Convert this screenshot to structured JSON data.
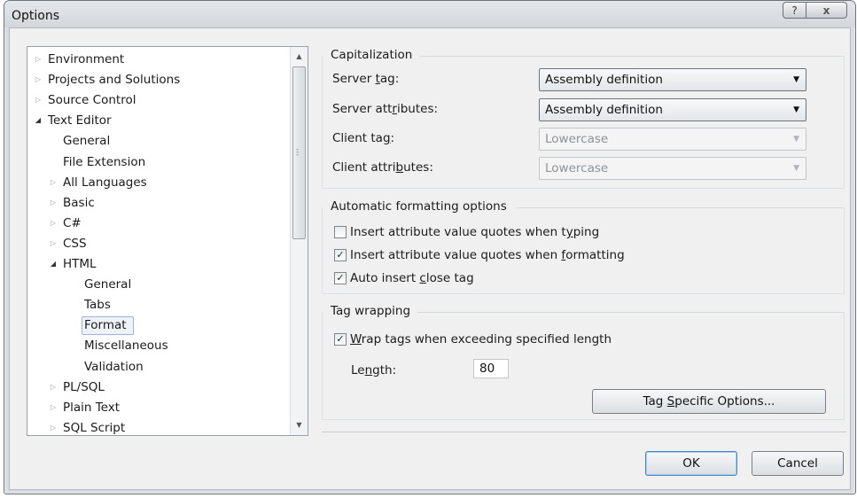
{
  "window": {
    "title": "Options",
    "help_icon": "?",
    "close_icon": "x"
  },
  "tree": {
    "items": [
      {
        "label": "Environment",
        "expander": "collapsed"
      },
      {
        "label": "Projects and Solutions",
        "expander": "collapsed"
      },
      {
        "label": "Source Control",
        "expander": "collapsed"
      },
      {
        "label": "Text Editor",
        "expander": "expanded"
      },
      {
        "label": "General",
        "expander": "none"
      },
      {
        "label": "File Extension",
        "expander": "none"
      },
      {
        "label": "All Languages",
        "expander": "collapsed"
      },
      {
        "label": "Basic",
        "expander": "collapsed"
      },
      {
        "label": "C#",
        "expander": "collapsed"
      },
      {
        "label": "CSS",
        "expander": "collapsed"
      },
      {
        "label": "HTML",
        "expander": "expanded"
      },
      {
        "label": "General",
        "expander": "none"
      },
      {
        "label": "Tabs",
        "expander": "none"
      },
      {
        "label": "Format",
        "expander": "none",
        "selected": true
      },
      {
        "label": "Miscellaneous",
        "expander": "none"
      },
      {
        "label": "Validation",
        "expander": "none"
      },
      {
        "label": "PL/SQL",
        "expander": "collapsed"
      },
      {
        "label": "Plain Text",
        "expander": "collapsed"
      },
      {
        "label": "SQL Script",
        "expander": "collapsed"
      }
    ],
    "icons": {
      "collapsed": "▷",
      "expanded": "◢",
      "scroll_up": "▲",
      "scroll_down": "▼"
    }
  },
  "capitalization": {
    "heading": "Capitalization",
    "server_tag": {
      "label": "Server tag:",
      "value": "Assembly definition"
    },
    "server_attributes": {
      "label": "Server attributes:",
      "value": "Assembly definition"
    },
    "client_tag": {
      "label": "Client tag:",
      "value": "Lowercase"
    },
    "client_attributes": {
      "label": "Client attributes:",
      "value": "Lowercase"
    }
  },
  "formatting": {
    "heading": "Automatic formatting options",
    "insert_quotes_typing": {
      "label": "Insert attribute value quotes when typing",
      "checked": false
    },
    "insert_quotes_formatting": {
      "label": "Insert attribute value quotes when formatting",
      "checked": true
    },
    "auto_close_tag": {
      "label": "Auto insert close tag",
      "checked": true
    }
  },
  "tag_wrapping": {
    "heading": "Tag wrapping",
    "wrap_tags": {
      "label": "Wrap tags when exceeding specified length",
      "checked": true
    },
    "length_label": "Length:",
    "length_value": "80",
    "tag_specific_button": "Tag Specific Options..."
  },
  "footer": {
    "ok": "OK",
    "cancel": "Cancel"
  },
  "glyphs": {
    "check": "✓",
    "dropdown": "▼"
  }
}
